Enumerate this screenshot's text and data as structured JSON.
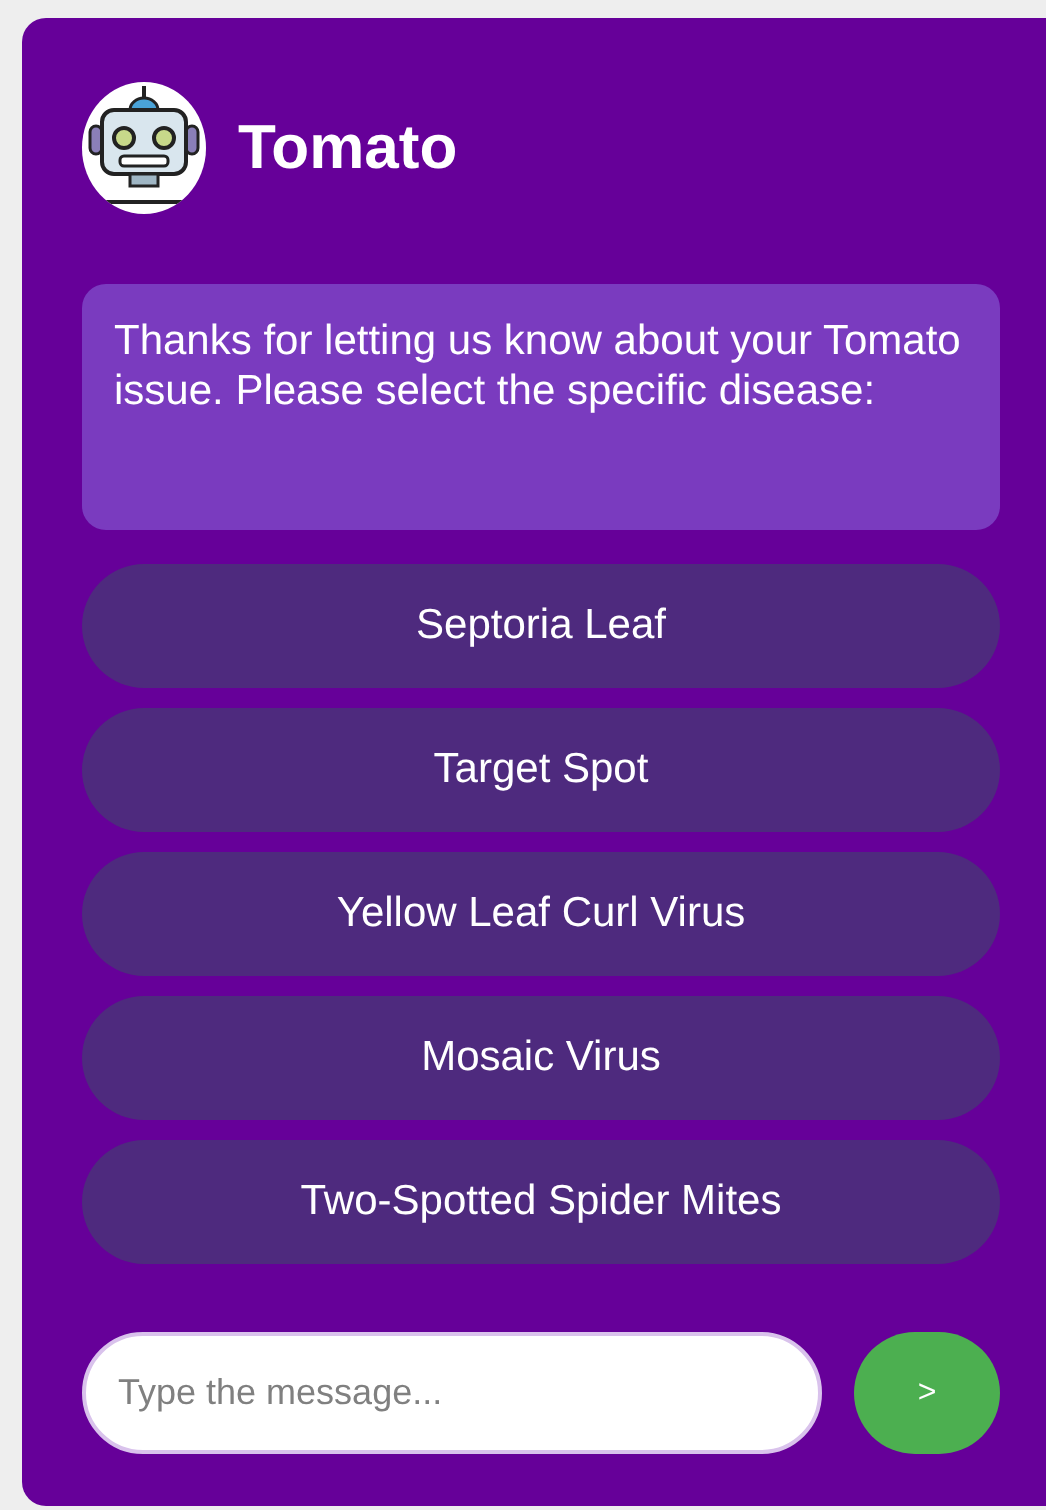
{
  "header": {
    "title": "Tomato"
  },
  "bot_message": "Thanks for letting us know about your Tomato issue. Please select the specific disease:",
  "options": [
    "Septoria Leaf",
    "Target Spot",
    "Yellow Leaf Curl Virus",
    "Mosaic Virus",
    "Two-Spotted Spider Mites"
  ],
  "composer": {
    "placeholder": "Type the message...",
    "send_label": ">"
  }
}
